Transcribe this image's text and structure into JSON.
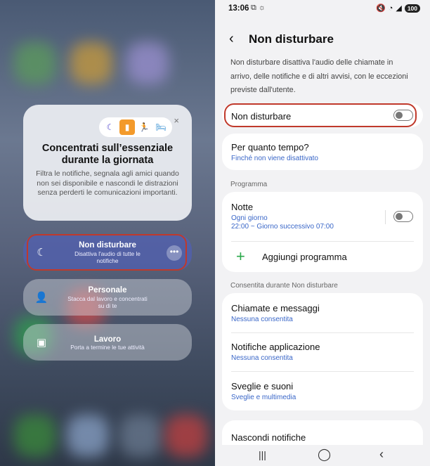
{
  "left": {
    "focus_card": {
      "title": "Concentrati sull’essenziale durante la giornata",
      "description": "Filtra le notifiche, segnala agli amici quando non sei disponibile e nascondi le distrazioni senza perderti le comunicazioni importanti.",
      "close": "×",
      "icons": [
        "moon-icon",
        "book-icon",
        "running-icon",
        "bed-icon"
      ]
    },
    "modes": [
      {
        "title": "Non disturbare",
        "subtitle": "Disattiva l'audio di tutte le notifiche",
        "icon": "moon-icon",
        "more": "•••"
      },
      {
        "title": "Personale",
        "subtitle": "Stacca dal lavoro e concentrati su di te",
        "icon": "person-icon"
      },
      {
        "title": "Lavoro",
        "subtitle": "Porta a termine le tue attività",
        "icon": "badge-icon"
      }
    ]
  },
  "right": {
    "status": {
      "time": "13:06",
      "battery": "100"
    },
    "header": {
      "title": "Non disturbare"
    },
    "intro": "Non disturbare disattiva l'audio delle chiamate in arrivo, delle notifiche e di altri avvisi, con le eccezioni previste dall'utente.",
    "dnd_toggle": {
      "label": "Non disturbare",
      "on": false
    },
    "duration": {
      "title": "Per quanto tempo?",
      "value": "Finché non viene disattivato"
    },
    "programma_header": "Programma",
    "schedule": {
      "title": "Notte",
      "line1": "Ogni giorno",
      "line2": "22:00 ~ Giorno successivo 07:00",
      "on": false
    },
    "add_schedule": "Aggiungi programma",
    "allowed_header": "Consentita durante Non disturbare",
    "allowed": [
      {
        "title": "Chiamate e messaggi",
        "value": "Nessuna consentita"
      },
      {
        "title": "Notifiche applicazione",
        "value": "Nessuna consentita"
      },
      {
        "title": "Sveglie e suoni",
        "value": "Sveglie e multimedia"
      }
    ],
    "hide_notifications": "Nascondi notifiche"
  }
}
